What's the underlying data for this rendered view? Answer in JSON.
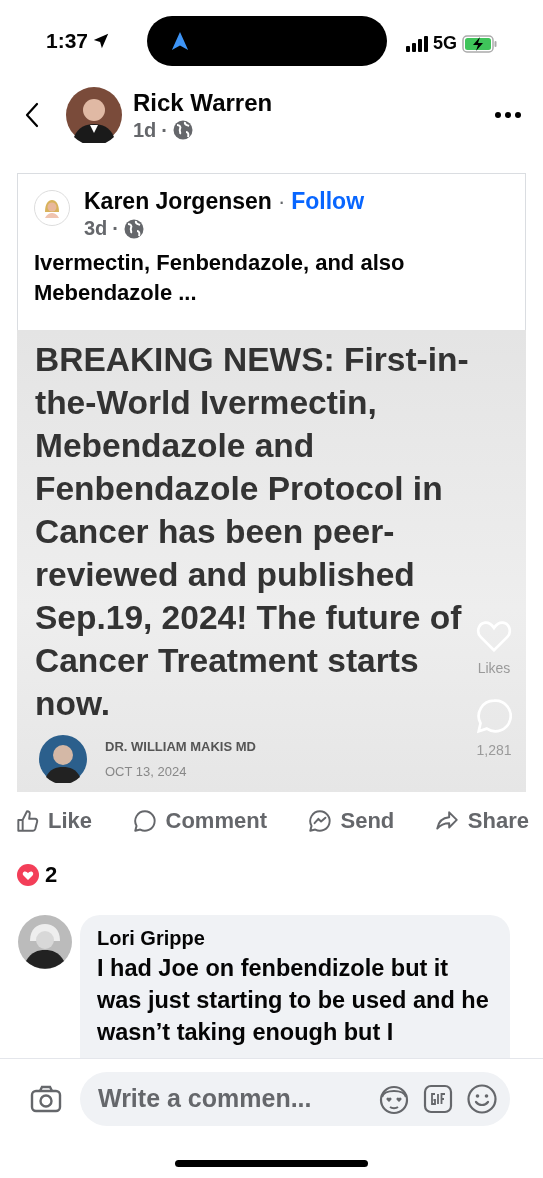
{
  "status_bar": {
    "time": "1:37",
    "network": "5G"
  },
  "header": {
    "author": "Rick Warren",
    "time": "1d",
    "separator": "·"
  },
  "shared_post": {
    "author": "Karen Jorgensen",
    "separator": "·",
    "follow": "Follow",
    "time": "3d",
    "time_separator": "·",
    "text": "Ivermectin, Fenbendazole, and also Mebendazole ...",
    "image": {
      "headline": "BREAKING NEWS: First-in-the-World Ivermectin, Mebendazole and Fenbendazole Protocol in Cancer has been peer-reviewed and published Sep.19, 2024! The future of Cancer Treatment starts now.",
      "byline": "DR. WILLIAM MAKIS MD",
      "date": "OCT 13, 2024",
      "likes_label": "Likes",
      "comment_count": "1,281"
    }
  },
  "actions": [
    {
      "kind": "like",
      "label": "Like"
    },
    {
      "kind": "comment",
      "label": "Comment"
    },
    {
      "kind": "send",
      "label": "Send"
    },
    {
      "kind": "share",
      "label": "Share"
    }
  ],
  "reactions": {
    "count": "2"
  },
  "comments": [
    {
      "author": "Lori Grippe",
      "text": "I had Joe on fenbendizole but it was just starting to be used and he wasn’t taking enough but I"
    }
  ],
  "composer": {
    "placeholder": "Write a commen..."
  }
}
